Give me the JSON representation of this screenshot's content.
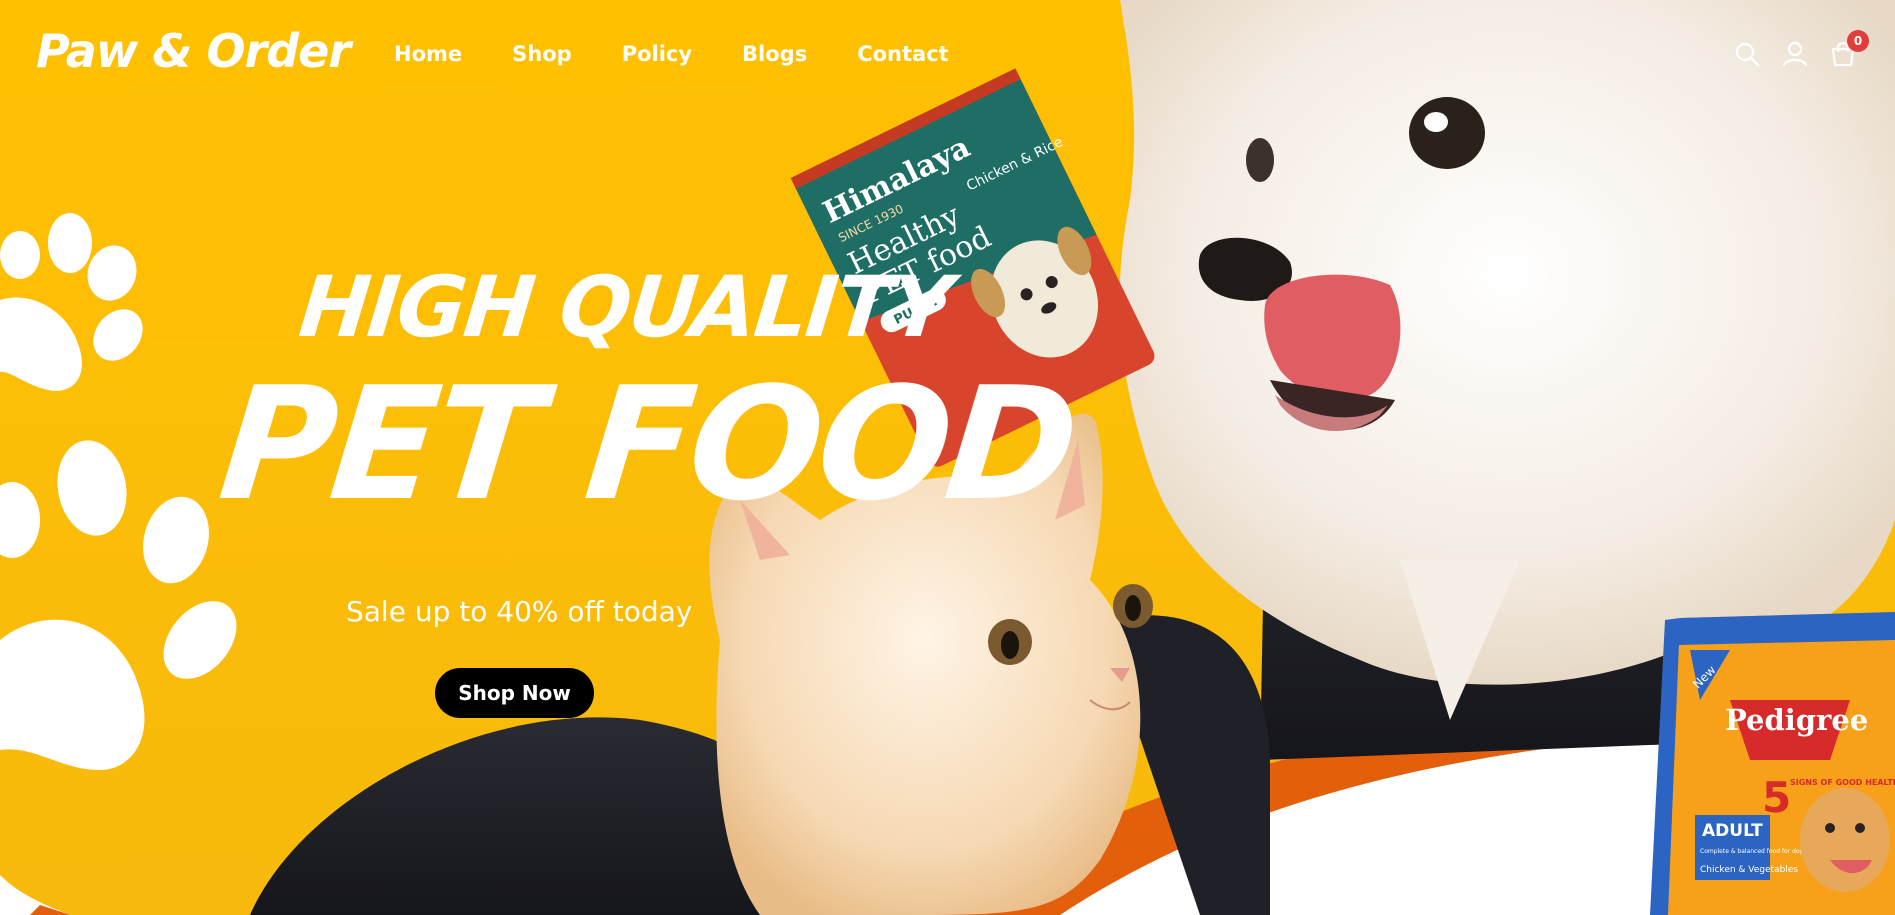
{
  "header": {
    "logo": "Paw & Order",
    "nav": [
      "Home",
      "Shop",
      "Policy",
      "Blogs",
      "Contact"
    ],
    "cart_count": "0",
    "icons": [
      "search-icon",
      "user-icon",
      "cart-icon"
    ]
  },
  "hero": {
    "headline_small": "HIGH QUALITY",
    "headline_big": "PET FOOD",
    "subtitle": "Sale up to 40% off today",
    "cta_label": "Shop Now"
  },
  "products": {
    "bag_left": {
      "brand": "Himalaya",
      "since": "SINCE 1930",
      "name_line1": "Healthy",
      "name_line2": "PET food",
      "flavor": "Chicken & Rice",
      "tag": "PUPPY"
    },
    "bag_right": {
      "brand": "Pedigree",
      "tag": "New",
      "signs_number": "5",
      "signs_text": "SIGNS OF GOOD HEALTH",
      "variant": "ADULT",
      "desc": "Complete & balanced food for dogs",
      "flavor": "Chicken & Vegetables"
    }
  },
  "colors": {
    "background": "#ffc000",
    "accent_orange": "#e35f0c",
    "button": "#000000",
    "text": "#ffffff",
    "badge": "#e23d3d"
  }
}
